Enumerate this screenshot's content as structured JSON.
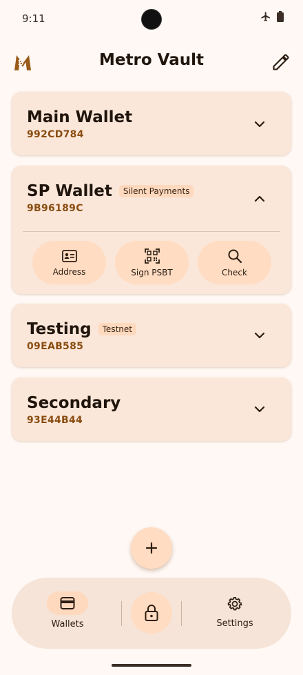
{
  "status_bar": {
    "time": "9:11",
    "icons": [
      "airplane-icon",
      "battery-icon"
    ]
  },
  "app_bar": {
    "title": "Metro Vault",
    "logo_icon": "bitcoin-m-logo-icon",
    "edit_icon": "pencil-icon"
  },
  "wallets": [
    {
      "name": "Main Wallet",
      "fingerprint": "992CD784",
      "chip": "",
      "expanded": false
    },
    {
      "name": "SP Wallet",
      "fingerprint": "9B96189C",
      "chip": "Silent Payments",
      "expanded": true,
      "actions": [
        {
          "label": "Address",
          "icon": "id-card-icon"
        },
        {
          "label": "Sign PSBT",
          "icon": "qr-code-icon"
        },
        {
          "label": "Check",
          "icon": "magnifier-icon"
        }
      ]
    },
    {
      "name": "Testing",
      "fingerprint": "09EAB585",
      "chip": "Testnet",
      "expanded": false
    },
    {
      "name": "Secondary",
      "fingerprint": "93E44B44",
      "chip": "",
      "expanded": false
    }
  ],
  "fab": {
    "icon": "plus-icon"
  },
  "bottom_nav": {
    "wallets_label": "Wallets",
    "settings_label": "Settings",
    "lock_icon": "lock-icon"
  },
  "colors": {
    "background": "#FFF8F4",
    "card": "#FAE7D9",
    "accent": "#FFDCC2",
    "fingerprint": "#8A4D12",
    "logo": "#9A5A1A"
  }
}
